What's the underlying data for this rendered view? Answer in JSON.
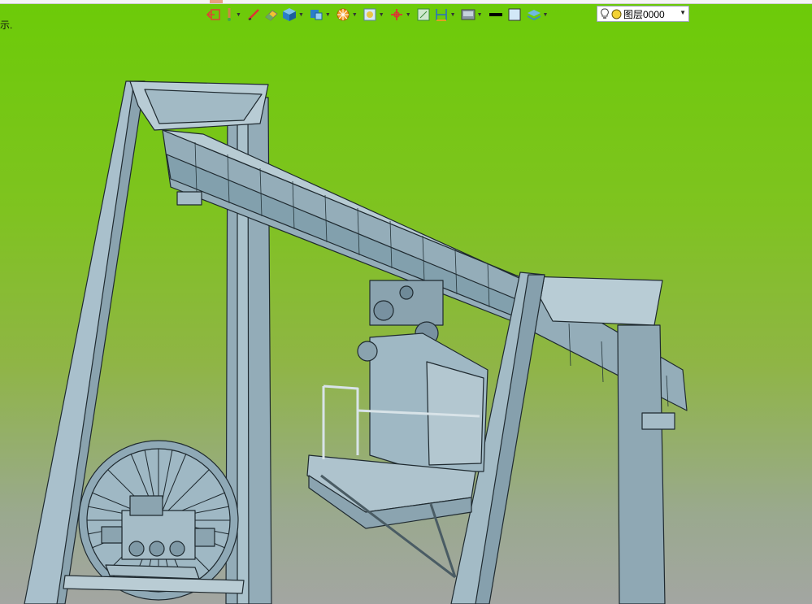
{
  "hint_text": "示.",
  "toolbar": {
    "items": [
      {
        "icon": "exit-sketch-icon",
        "dropdown": false
      },
      {
        "icon": "pen-sketch-icon",
        "dropdown": true
      },
      {
        "icon": "line-tool-icon",
        "dropdown": false
      },
      {
        "icon": "eraser-icon",
        "dropdown": false
      },
      {
        "icon": "cube-icon",
        "dropdown": true
      },
      {
        "icon": "views-icon",
        "dropdown": true
      },
      {
        "icon": "section-view-icon",
        "dropdown": true
      },
      {
        "icon": "render-icon",
        "dropdown": true
      },
      {
        "icon": "rotate-icon",
        "dropdown": true
      },
      {
        "icon": "grid-icon",
        "dropdown": false
      },
      {
        "icon": "dimension-icon",
        "dropdown": true
      },
      {
        "icon": "display-style-icon",
        "dropdown": true
      },
      {
        "icon": "line-weight-icon",
        "dropdown": false
      },
      {
        "icon": "color-swatch-icon",
        "dropdown": false
      },
      {
        "icon": "layer-stack-icon",
        "dropdown": true
      }
    ]
  },
  "layer_select": {
    "value": "图层0000"
  },
  "colors": {
    "background_top": "#6ccb08",
    "background_bottom": "#a3a6a2",
    "model_steel": "#9bb4c0",
    "model_edge": "#1f2a30"
  }
}
